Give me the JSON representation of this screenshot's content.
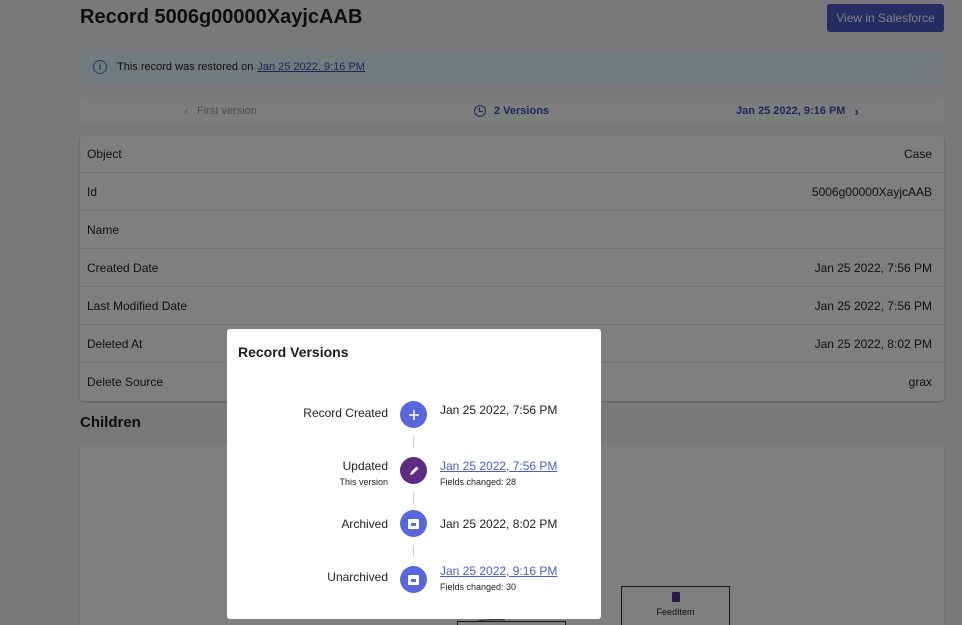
{
  "header": {
    "title": "Record 5006g00000XayjcAAB",
    "view_button": "View in Salesforce"
  },
  "banner": {
    "text": "This record was restored on",
    "link": "Jan 25 2022, 9:16 PM"
  },
  "version_bar": {
    "first": "First version",
    "count": "2 Versions",
    "next": "Jan 25 2022, 9:16 PM"
  },
  "fields": [
    {
      "label": "Object",
      "value": "Case"
    },
    {
      "label": "Id",
      "value": "5006g00000XayjcAAB"
    },
    {
      "label": "Name",
      "value": ""
    },
    {
      "label": "Created Date",
      "value": "Jan 25 2022, 7:56 PM"
    },
    {
      "label": "Last Modified Date",
      "value": "Jan 25 2022, 7:56 PM"
    },
    {
      "label": "Deleted At",
      "value": "Jan 25 2022, 8:02 PM"
    },
    {
      "label": "Delete Source",
      "value": "grax"
    }
  ],
  "children": {
    "title": "Children",
    "node_label": "FeedItem"
  },
  "modal": {
    "title": "Record Versions",
    "events": [
      {
        "label": "Record Created",
        "sub": "",
        "date": "Jan 25 2022, 7:56 PM",
        "meta": "",
        "icon": "plus-icon"
      },
      {
        "label": "Updated",
        "sub": "This version",
        "date": "Jan 25 2022, 7:56 PM",
        "meta": "Fields changed: 28",
        "icon": "pencil-icon"
      },
      {
        "label": "Archived",
        "sub": "",
        "date": "Jan 25 2022, 8:02 PM",
        "meta": "",
        "icon": "archive-icon"
      },
      {
        "label": "Unarchived",
        "sub": "",
        "date": "Jan 25 2022, 9:16 PM",
        "meta": "Fields changed: 30",
        "icon": "unarchive-icon"
      }
    ]
  },
  "colors": {
    "primary": "#4c5acb",
    "timeline_blue": "#5867dd",
    "timeline_purple": "#5e2a84",
    "banner_bg": "#e4f5fb"
  }
}
